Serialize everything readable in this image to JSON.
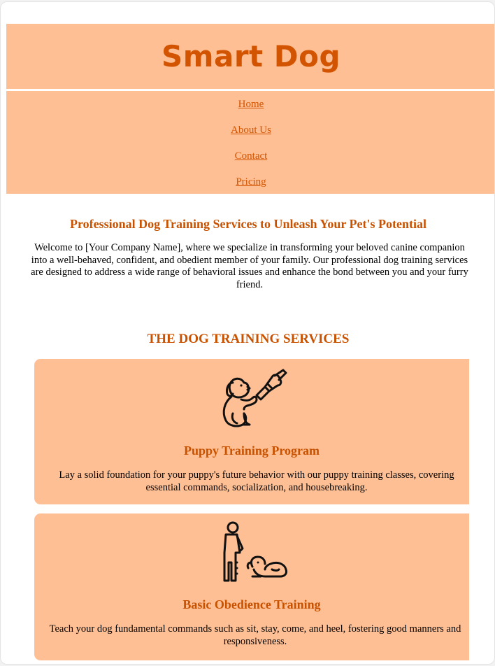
{
  "site": {
    "title": "Smart Dog"
  },
  "nav": {
    "items": [
      {
        "label": "Home"
      },
      {
        "label": "About Us"
      },
      {
        "label": "Contact"
      },
      {
        "label": "Pricing"
      }
    ]
  },
  "intro": {
    "heading": "Professional Dog Training Services to Unleash Your Pet's Potential",
    "text": "Welcome to [Your Company Name], where we specialize in transforming your beloved canine companion into a well-behaved, confident, and obedient member of your family. Our professional dog training services are designed to address a wide range of behavioral issues and enhance the bond between you and your furry friend."
  },
  "services": {
    "heading": "THE DOG TRAINING SERVICES",
    "items": [
      {
        "icon": "puppy-training-icon",
        "title": "Puppy Training Program",
        "description": "Lay a solid foundation for your puppy's future behavior with our puppy training classes, covering essential commands, socialization, and housebreaking."
      },
      {
        "icon": "obedience-training-icon",
        "title": "Basic Obedience Training",
        "description": "Teach your dog fundamental commands such as sit, stay, come, and heel, fostering good manners and responsiveness."
      }
    ]
  },
  "colors": {
    "accent": "#d35400",
    "panel": "#ffbf94",
    "background": "#ffffff"
  }
}
